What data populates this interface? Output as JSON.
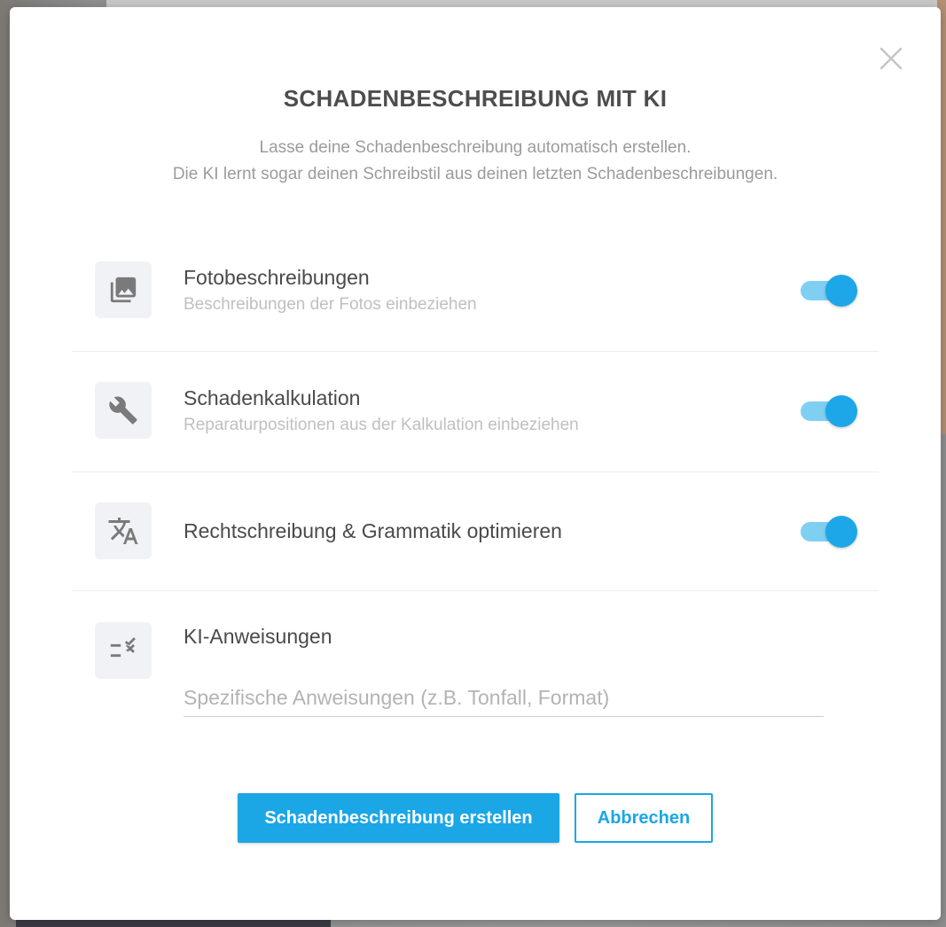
{
  "dialog": {
    "title": "SCHADENBESCHREIBUNG MIT KI",
    "subtitle_line1": "Lasse deine Schadenbeschreibung automatisch erstellen.",
    "subtitle_line2": "Die KI lernt sogar deinen Schreibstil aus deinen letzten Schadenbeschreibungen.",
    "close_icon": "close-icon"
  },
  "options": [
    {
      "icon": "photo-library-icon",
      "title": "Fotobeschreibungen",
      "description": "Beschreibungen der Fotos einbeziehen",
      "enabled": true
    },
    {
      "icon": "wrench-icon",
      "title": "Schadenkalkulation",
      "description": "Reparaturpositionen aus der Kalkulation einbeziehen",
      "enabled": true
    },
    {
      "icon": "translate-icon",
      "title": "Rechtschreibung & Grammatik optimieren",
      "enabled": true
    }
  ],
  "instructions": {
    "icon": "rule-icon",
    "title": "KI-Anweisungen",
    "value": "",
    "placeholder": "Spezifische Anweisungen (z.B. Tonfall, Format)"
  },
  "buttons": {
    "submit_label": "Schadenbeschreibung erstellen",
    "cancel_label": "Abbrechen"
  },
  "colors": {
    "accent": "#1ba6e6",
    "toggle_track": "#7fcff3",
    "title_text": "#4d4d4d",
    "muted_text": "#9b9b9b"
  }
}
